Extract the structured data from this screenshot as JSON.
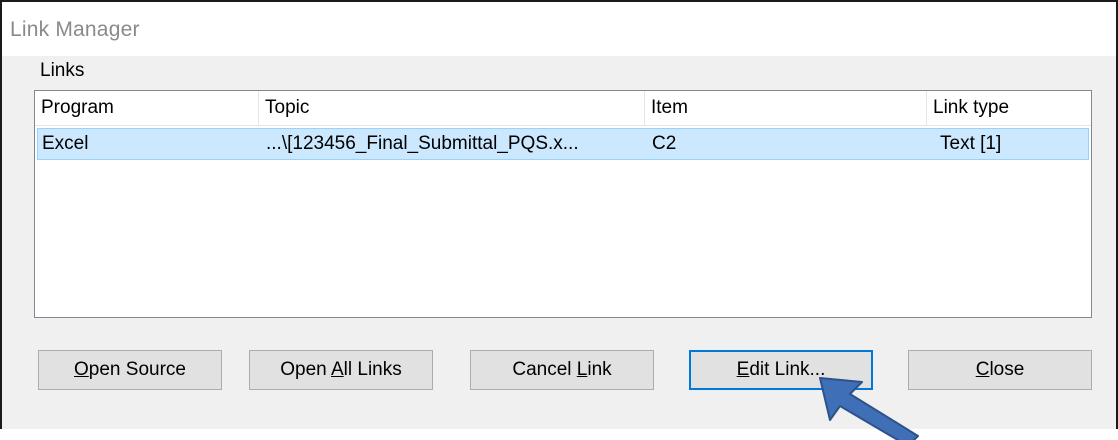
{
  "window": {
    "title": "Link Manager"
  },
  "links_group": {
    "label": "Links"
  },
  "list": {
    "columns": [
      "Program",
      "Topic",
      "Item",
      "Link type"
    ],
    "rows": [
      {
        "program": "Excel",
        "topic": "...\\[123456_Final_Submittal_PQS.x...",
        "item": "C2",
        "link_type": "Text [1]",
        "selected": true
      }
    ]
  },
  "buttons": {
    "open_source": {
      "pre": "",
      "mnemonic": "O",
      "post": "pen Source"
    },
    "open_all_links": {
      "pre": "Open ",
      "mnemonic": "A",
      "post": "ll Links"
    },
    "cancel_link": {
      "pre": "Cancel ",
      "mnemonic": "L",
      "post": "ink"
    },
    "edit_link": {
      "pre": "",
      "mnemonic": "E",
      "post": "dit Link..."
    },
    "close": {
      "pre": "",
      "mnemonic": "C",
      "post": "lose"
    }
  },
  "colors": {
    "selection_fill": "#cce8ff",
    "selection_border": "#99d1ff",
    "annotation_arrow": "#3f6fb6"
  },
  "annotation": {
    "icon": "arrow-pointer-icon",
    "target": "edit_link"
  }
}
